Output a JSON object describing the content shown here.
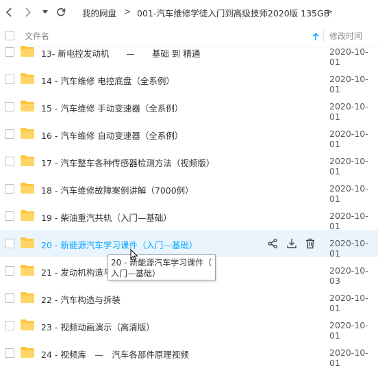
{
  "toolbar": {
    "back_icon": "chevron-left-icon",
    "forward_icon": "chevron-right-icon",
    "dropdown_icon": "caret-down-icon",
    "refresh_icon": "refresh-icon",
    "breadcrumb": [
      "我的网盘",
      ">",
      "001-汽车维修学徒入门到高级技师2020版 135GB",
      ">"
    ]
  },
  "header": {
    "name_label": "文件名",
    "sort_icon": "arrow-up-icon",
    "date_label": "修改时间"
  },
  "files": [
    {
      "name": "13- 新电控发动机　　—　　基础 到 精通",
      "date": "2020-10-01"
    },
    {
      "name": "14 - 汽车维修 电控底盘（全系例）",
      "date": "2020-10-01"
    },
    {
      "name": "15 - 汽车维修 手动变速器（全系例）",
      "date": "2020-10-01"
    },
    {
      "name": "16 - 汽车维修 自动变速器（全系例）",
      "date": "2020-10-01"
    },
    {
      "name": "17 - 汽车整车各种传感器检测方法（视频版）",
      "date": "2020-10-01"
    },
    {
      "name": "18 - 汽车维修故障案例讲解（7000例）",
      "date": "2020-10-01"
    },
    {
      "name": "19 - 柴油重汽共轨（入门—基础）",
      "date": "2020-10-01"
    },
    {
      "name": "20 - 新能源汽车学习课件（入门—基础）",
      "date": "2020-10-01"
    },
    {
      "name": "21 - 发动机构造与",
      "date": "2020-10-03"
    },
    {
      "name": "22 - 汽车构造与拆装",
      "date": "2020-10-01"
    },
    {
      "name": "23 - 视频动画演示（高清版）",
      "date": "2020-10-01"
    },
    {
      "name": "24 - 视频库　—　汽车各部件原理视频",
      "date": "2020-10-01"
    }
  ],
  "hover_row_index": 7,
  "row_actions": [
    "share-icon",
    "download-icon",
    "delete-icon"
  ],
  "tooltip": {
    "line1": "20 - 新能源汽车学习课件（",
    "line2": "入门—基础）"
  },
  "colors": {
    "accent": "#06a7ff",
    "folder": "#ffc53d",
    "hover_bg": "#eaf4fd"
  }
}
